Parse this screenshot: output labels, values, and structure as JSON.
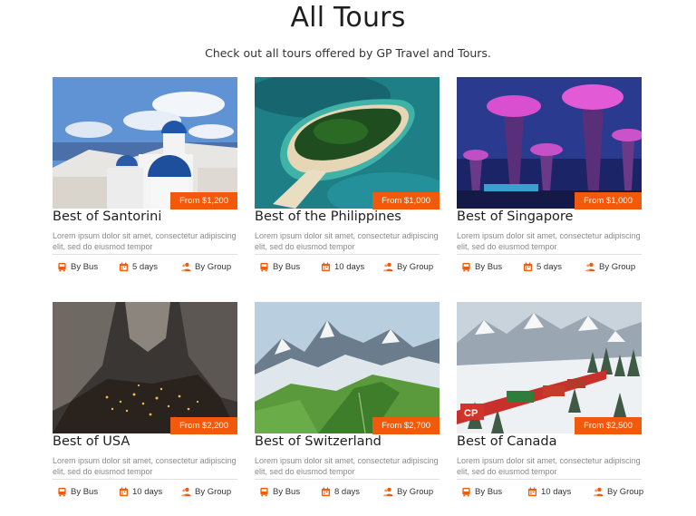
{
  "header": {
    "title": "All Tours",
    "subtitle": "Check out all tours offered by GP Travel and Tours."
  },
  "colors": {
    "accent": "#f15a0c",
    "text": "#1f1f1f",
    "muted": "#8a8a8a"
  },
  "icons": {
    "transport": "bus-icon",
    "duration": "calendar-icon",
    "group": "group-icon"
  },
  "tours": [
    {
      "title": "Best of Santorini",
      "price": "From $1,200",
      "description": "Lorem ipsum dolor sit amet, consectetur adipiscing elit, sed do eiusmod tempor",
      "transport": "By Bus",
      "duration": "5 days",
      "group": "By Group"
    },
    {
      "title": "Best of the Philippines",
      "price": "From $1,000",
      "description": "Lorem ipsum dolor sit amet, consectetur adipiscing elit, sed do eiusmod tempor",
      "transport": "By Bus",
      "duration": "10 days",
      "group": "By Group"
    },
    {
      "title": "Best of Singapore",
      "price": "From $1,000",
      "description": "Lorem ipsum dolor sit amet, consectetur adipiscing elit, sed do eiusmod tempor",
      "transport": "By Bus",
      "duration": "5 days",
      "group": "By Group"
    },
    {
      "title": "Best of USA",
      "price": "From $2,200",
      "description": "Lorem ipsum dolor sit amet, consectetur adipiscing elit, sed do eiusmod tempor",
      "transport": "By Bus",
      "duration": "10 days",
      "group": "By Group"
    },
    {
      "title": "Best of Switzerland",
      "price": "From $2,700",
      "description": "Lorem ipsum dolor sit amet, consectetur adipiscing elit, sed do eiusmod tempor",
      "transport": "By Bus",
      "duration": "8 days",
      "group": "By Group"
    },
    {
      "title": "Best of Canada",
      "price": "From $2,500",
      "description": "Lorem ipsum dolor sit amet, consectetur adipiscing elit, sed do eiusmod tempor",
      "transport": "By Bus",
      "duration": "10 days",
      "group": "By Group"
    }
  ]
}
